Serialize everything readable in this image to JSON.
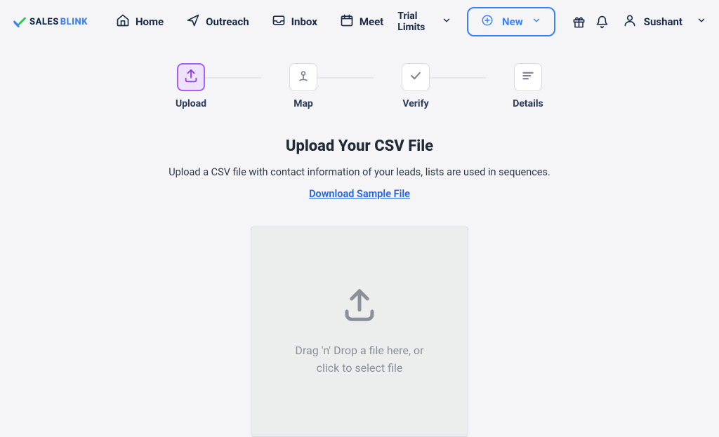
{
  "brand": {
    "name_a": "SALES",
    "name_b": "BLINK"
  },
  "nav": {
    "home": "Home",
    "outreach": "Outreach",
    "inbox": "Inbox",
    "meet": "Meet"
  },
  "trial_label": "Trial Limits",
  "new_label": "New",
  "user_name": "Sushant",
  "stepper": {
    "upload": "Upload",
    "map": "Map",
    "verify": "Verify",
    "details": "Details"
  },
  "upload": {
    "headline": "Upload Your CSV File",
    "subtext": "Upload a CSV file with contact information of your leads, lists are used in sequences.",
    "sample_link": "Download Sample File",
    "dropzone": "Drag 'n' Drop a file here, or click to select file"
  }
}
